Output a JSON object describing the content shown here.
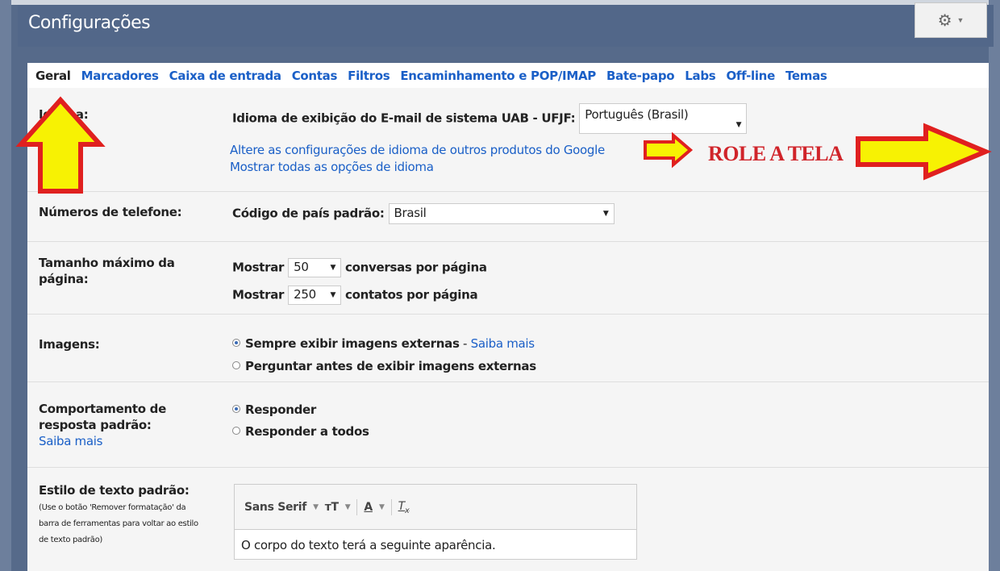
{
  "header": {
    "title": "Configurações"
  },
  "tabs": [
    {
      "label": "Geral",
      "active": true
    },
    {
      "label": "Marcadores"
    },
    {
      "label": "Caixa de entrada"
    },
    {
      "label": "Contas"
    },
    {
      "label": "Filtros"
    },
    {
      "label": "Encaminhamento e POP/IMAP"
    },
    {
      "label": "Bate-papo"
    },
    {
      "label": "Labs"
    },
    {
      "label": "Off-line"
    },
    {
      "label": "Temas"
    }
  ],
  "idioma": {
    "label": "Idioma:",
    "display_label": "Idioma de exibição do E-mail de sistema UAB - UFJF:",
    "selected": "Português (Brasil)",
    "link1": "Altere as configurações de idioma de outros produtos do Google",
    "link2": "Mostrar todas as opções de idioma"
  },
  "telefone": {
    "label": "Números de telefone:",
    "country_label": "Código de país padrão:",
    "country": "Brasil"
  },
  "tamanho": {
    "label": "Tamanho máximo da página:",
    "show": "Mostrar",
    "conversas_value": "50",
    "conversas_suffix": "conversas por página",
    "contatos_value": "250",
    "contatos_suffix": "contatos por página"
  },
  "imagens": {
    "label": "Imagens:",
    "option1": "Sempre exibir imagens externas",
    "option1_sep": " - ",
    "option1_link": "Saiba mais",
    "option2": "Perguntar antes de exibir imagens externas",
    "selected": 1
  },
  "resposta": {
    "label": "Comportamento de resposta padrão:",
    "link": "Saiba mais",
    "option1": "Responder",
    "option2": "Responder a todos",
    "selected": 1
  },
  "estilo": {
    "label": "Estilo de texto padrão:",
    "hint": "(Use o botão 'Remover formatação' da barra de ferramentas para voltar ao estilo de texto padrão)",
    "font": "Sans Serif",
    "sample": "O corpo do texto terá a seguinte aparência."
  },
  "annotation": {
    "text": "ROLE A TELA",
    "color": "#d0242a",
    "arrow_fill": "#f7f203",
    "arrow_stroke": "#e0201f"
  }
}
